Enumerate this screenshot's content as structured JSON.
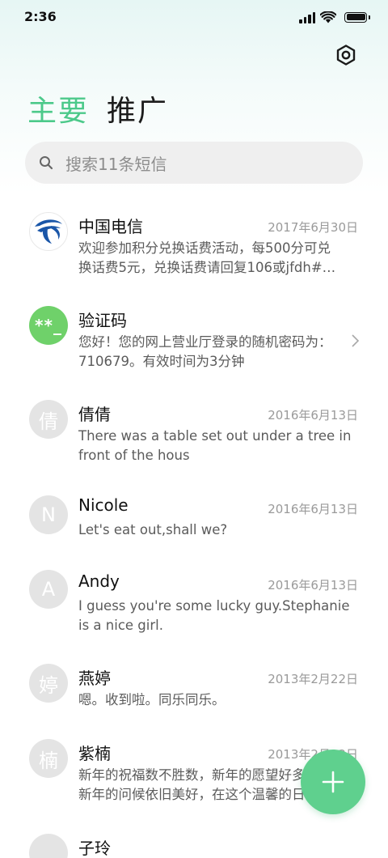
{
  "status_bar": {
    "time": "2:36"
  },
  "tabs": [
    {
      "label": "主要",
      "active": true
    },
    {
      "label": "推广",
      "active": false
    }
  ],
  "search": {
    "placeholder": "搜索11条短信"
  },
  "colors": {
    "accent": "#4cc98a",
    "fab": "#5fd08e",
    "verify_avatar": "#6fd16a",
    "telecom_blue": "#1a56a8"
  },
  "messages": [
    {
      "name": "中国电信",
      "date": "2017年6月30日",
      "line1": "欢迎参加积分兑换话费活动，每500分可兑",
      "line2": "换话费5元，兑换话费请回复106或jfdh#…",
      "avatar_icon": "china-telecom-logo-icon"
    },
    {
      "name": "验证码",
      "date": "",
      "line1": "您好！您的网上营业厅登录的随机密码为：",
      "line2": "710679。有效时间为3分钟",
      "avatar_text": "**_"
    },
    {
      "name": "倩倩",
      "date": "2016年6月13日",
      "line1": "There was a table set out under a tree in",
      "line2": "front of the hous",
      "avatar_text": "倩"
    },
    {
      "name": "Nicole",
      "date": "2016年6月13日",
      "line1": "Let's eat out,shall we?",
      "line2": "",
      "avatar_text": "N"
    },
    {
      "name": "Andy",
      "date": "2016年6月13日",
      "line1": "I guess you're some lucky guy.Stephanie",
      "line2": "is a nice girl.",
      "avatar_text": "A"
    },
    {
      "name": "燕婷",
      "date": "2013年2月22日",
      "line1": "嗯。收到啦。同乐同乐。",
      "line2": "",
      "avatar_text": "婷"
    },
    {
      "name": "紫楠",
      "date": "2013年2月22日",
      "line1": "新年的祝福数不胜数，新年的愿望好多好",
      "line2": "新年的问候依旧美好，在这个温馨的日子",
      "avatar_text": "楠"
    },
    {
      "name": "子玲",
      "date": "",
      "line1": "",
      "line2": "",
      "avatar_text": ""
    }
  ]
}
